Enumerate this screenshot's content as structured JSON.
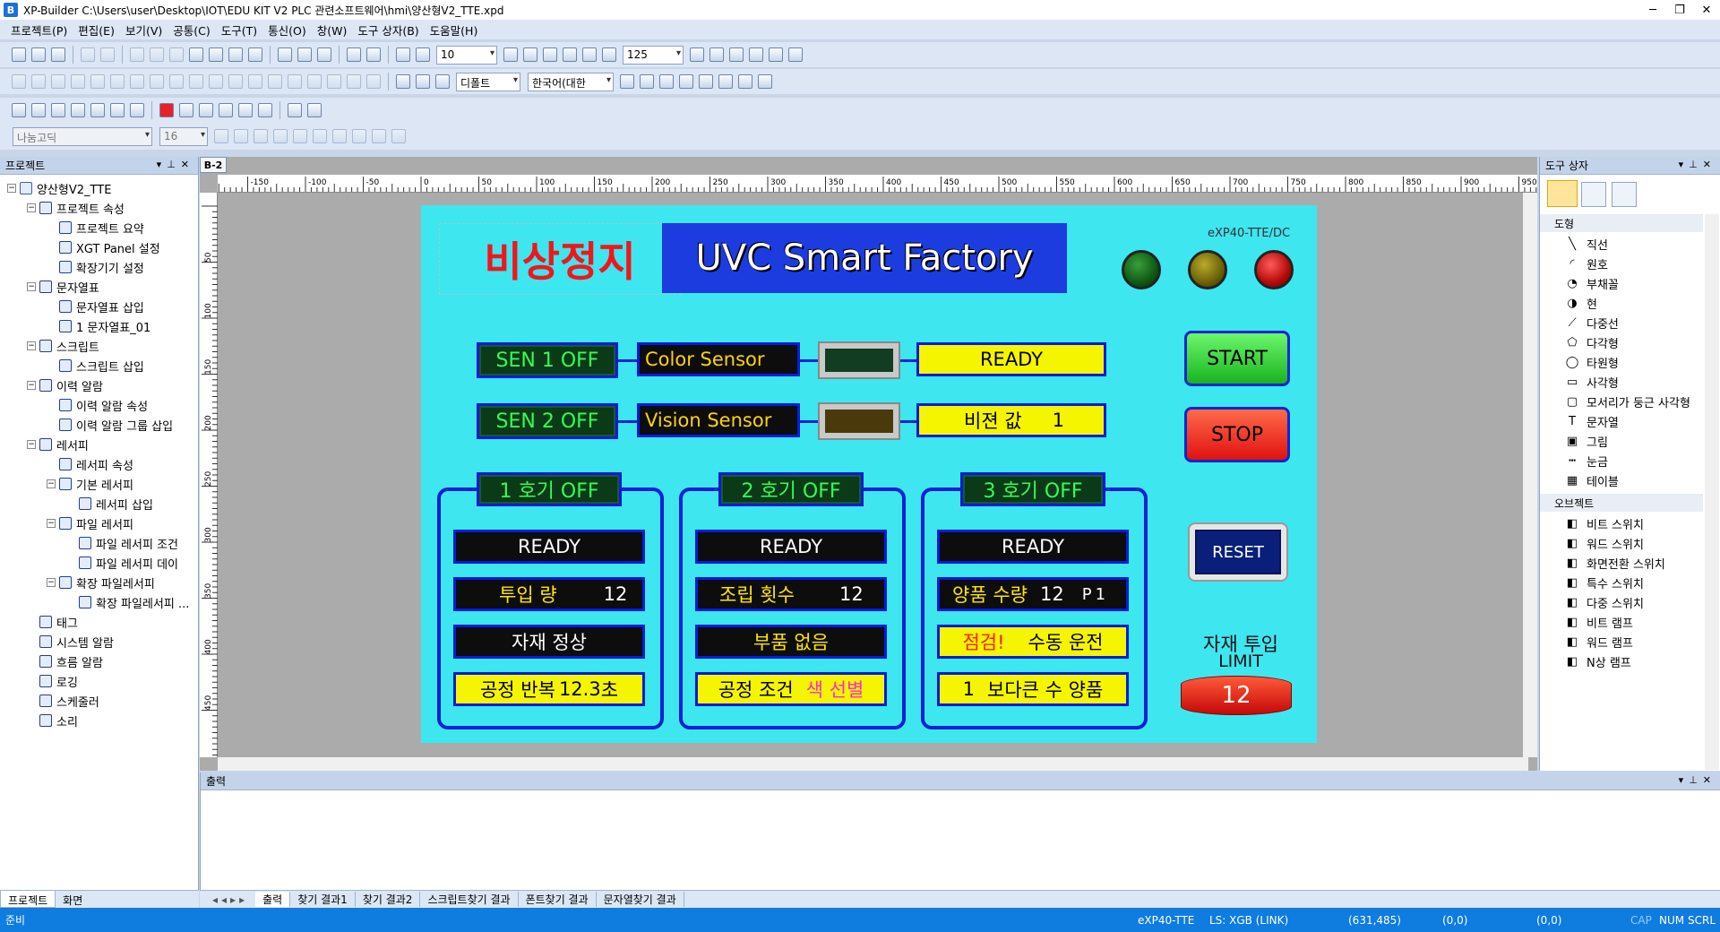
{
  "window": {
    "title": "XP-Builder C:\\Users\\user\\Desktop\\IOT\\EDU KIT V2 PLC 관련소프트웨어\\hmi\\양산형V2_TTE.xpd",
    "app_letter": "B"
  },
  "menu": [
    "프로젝트(P)",
    "편집(E)",
    "보기(V)",
    "공통(C)",
    "도구(T)",
    "통신(O)",
    "창(W)",
    "도구 상자(B)",
    "도움말(H)"
  ],
  "toolbar": {
    "grid_size": "10",
    "zoom": "125",
    "default_combo": "디폴트",
    "language": "한국어(대한",
    "font_name": "나눔고딕",
    "font_size": "16"
  },
  "project_panel": {
    "title": "프로젝트",
    "items": [
      {
        "label": "양산형V2_TTE",
        "level": 0
      },
      {
        "label": "프로젝트 속성",
        "level": 1
      },
      {
        "label": "프로젝트 요약",
        "level": 2
      },
      {
        "label": "XGT Panel 설정",
        "level": 2
      },
      {
        "label": "확장기기 설정",
        "level": 2
      },
      {
        "label": "문자열표",
        "level": 1
      },
      {
        "label": "문자열표 삽입",
        "level": 2
      },
      {
        "label": "1 문자열표_01",
        "level": 2
      },
      {
        "label": "스크립트",
        "level": 1
      },
      {
        "label": "스크립트 삽입",
        "level": 2
      },
      {
        "label": "이력 알람",
        "level": 1
      },
      {
        "label": "이력 알람 속성",
        "level": 2
      },
      {
        "label": "이력 알람 그룹 삽입",
        "level": 2
      },
      {
        "label": "레서피",
        "level": 1
      },
      {
        "label": "레서피 속성",
        "level": 2
      },
      {
        "label": "기본 레서피",
        "level": 2
      },
      {
        "label": "레서피 삽입",
        "level": 3
      },
      {
        "label": "파일 레서피",
        "level": 2
      },
      {
        "label": "파일 레서피 조건",
        "level": 3
      },
      {
        "label": "파일 레서피 데이",
        "level": 3
      },
      {
        "label": "확장 파일레서피",
        "level": 2
      },
      {
        "label": "확장 파일레서피 ...",
        "level": 3
      },
      {
        "label": "태그",
        "level": 1
      },
      {
        "label": "시스템 알람",
        "level": 1
      },
      {
        "label": "흐름 알람",
        "level": 1
      },
      {
        "label": "로깅",
        "level": 1
      },
      {
        "label": "스케줄러",
        "level": 1
      },
      {
        "label": "소리",
        "level": 1
      }
    ],
    "tabs": [
      "프로젝트",
      "화면"
    ]
  },
  "editor": {
    "tab": "B-2",
    "ruler": [
      "-150",
      "-100",
      "-50",
      "0",
      "50",
      "100",
      "150",
      "200",
      "250",
      "300",
      "350",
      "400",
      "450",
      "500",
      "550",
      "600",
      "650",
      "700",
      "750",
      "800",
      "850",
      "900",
      "950"
    ],
    "vruler": [
      "50",
      "100",
      "150",
      "200",
      "250",
      "300",
      "350",
      "400",
      "450"
    ]
  },
  "hmi": {
    "emergency": "비상정지",
    "title": "UVC Smart Factory",
    "model": "eXP40-TTE/DC",
    "lamps": {
      "green": "#0f5a12",
      "yellow": "#6b6208",
      "red": "#b50a0a"
    },
    "sen1": "SEN 1  OFF",
    "sen2": "SEN 2  OFF",
    "color_sensor": "Color Sensor",
    "vision_sensor": "Vision Sensor",
    "ready_top": "READY",
    "vision_value_label": "비젼 값",
    "vision_value": "1",
    "start": "START",
    "stop": "STOP",
    "reset": "RESET",
    "machine1": {
      "title": "1 호기 OFF",
      "ready": "READY",
      "input_label": "투입 량",
      "input_value": "12",
      "status": "자재 정상",
      "cycle_label": "공정 반복",
      "cycle_value": "12.3",
      "cycle_unit": "초"
    },
    "machine2": {
      "title": "2 호기 OFF",
      "ready": "READY",
      "assembly_label": "조립 횟수",
      "assembly_value": "12",
      "status": "부품 없음",
      "cond_label": "공정 조건",
      "cond_value": "색 선별"
    },
    "machine3": {
      "title": "3 호기 OFF",
      "ready": "READY",
      "good_label": "양품 수량",
      "good_value": "12",
      "p_label": "P",
      "p_value": "1",
      "check": "점검!",
      "mode": "수동 운전",
      "rule_value": "1",
      "rule_label": "보다큰 수 양품"
    },
    "limit_label1": "자재 투입",
    "limit_label2": "LIMIT",
    "limit_value": "12"
  },
  "toolbox": {
    "title": "도구 상자",
    "cat_shapes": "도형",
    "shapes": [
      "직선",
      "원호",
      "부채꼴",
      "현",
      "다중선",
      "다각형",
      "타원형",
      "사각형",
      "모서리가 둥근 사각형",
      "문자열",
      "그림",
      "눈금",
      "테이블"
    ],
    "cat_objects": "오브젝트",
    "objects": [
      "비트 스위치",
      "워드 스위치",
      "화면전환 스위치",
      "특수 스위치",
      "다중 스위치",
      "비트 램프",
      "워드 램프",
      "N상 램프"
    ]
  },
  "output": {
    "title": "출력",
    "tabs": [
      "출력",
      "찾기 결과1",
      "찾기 결과2",
      "스크립트찾기 결과",
      "폰트찾기 결과",
      "문자열찾기 결과"
    ]
  },
  "status": {
    "ready": "준비",
    "model": "eXP40-TTE",
    "link": "LS: XGB (LINK)",
    "coord": "(631,485)",
    "pos1": "(0,0)",
    "pos2": "(0,0)",
    "cap": "CAP",
    "num": "NUM",
    "scrl": "SCRL"
  }
}
